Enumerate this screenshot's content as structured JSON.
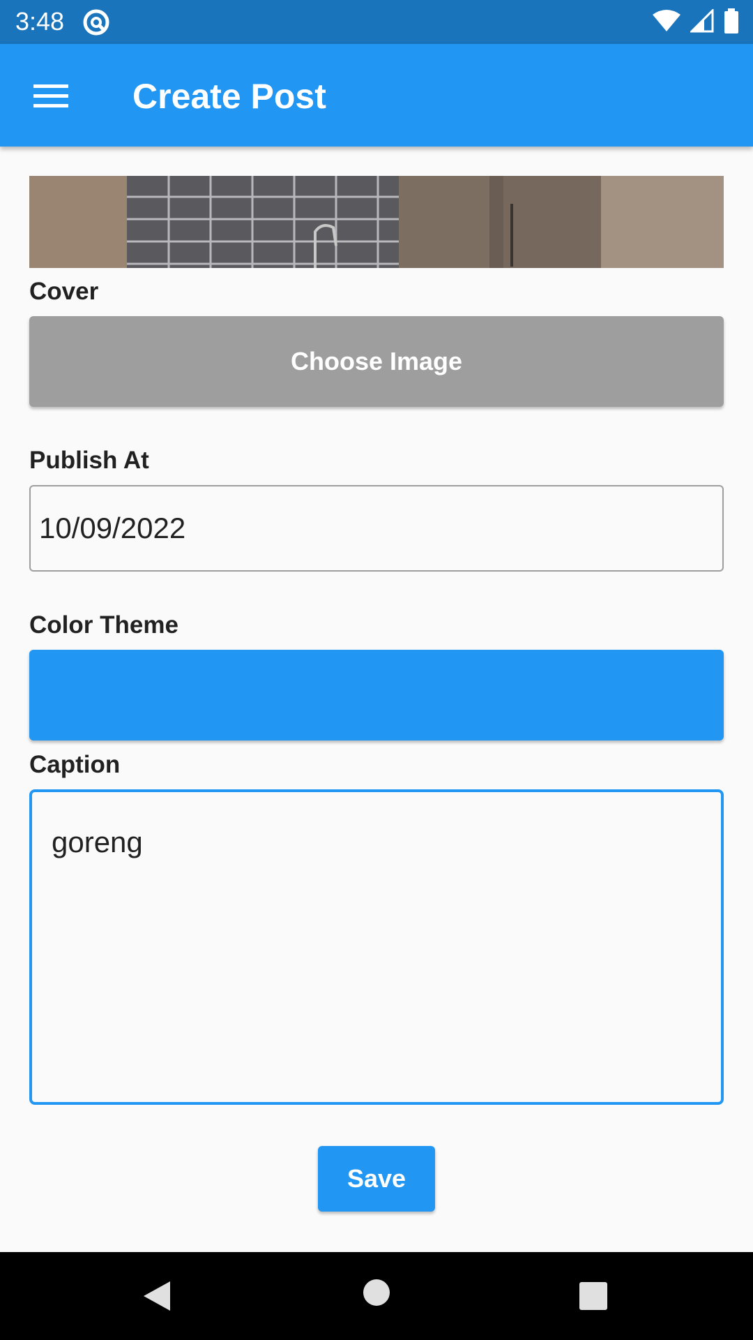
{
  "status_bar": {
    "time": "3:48",
    "icons": [
      "app-notification-icon",
      "wifi-icon",
      "cell-signal-icon",
      "battery-icon"
    ]
  },
  "app_bar": {
    "title": "Create Post",
    "menu_icon": "hamburger-menu-icon",
    "color": "#2196f3"
  },
  "form": {
    "cover_label": "Cover",
    "choose_image_label": "Choose Image",
    "publish_at_label": "Publish At",
    "publish_at_value": "10/09/2022",
    "color_theme_label": "Color Theme",
    "color_theme_value": "#2196f3",
    "caption_label": "Caption",
    "caption_value": "goreng",
    "save_label": "Save"
  },
  "nav_bar": {
    "icons": [
      "back-icon",
      "home-icon",
      "recents-icon"
    ]
  }
}
